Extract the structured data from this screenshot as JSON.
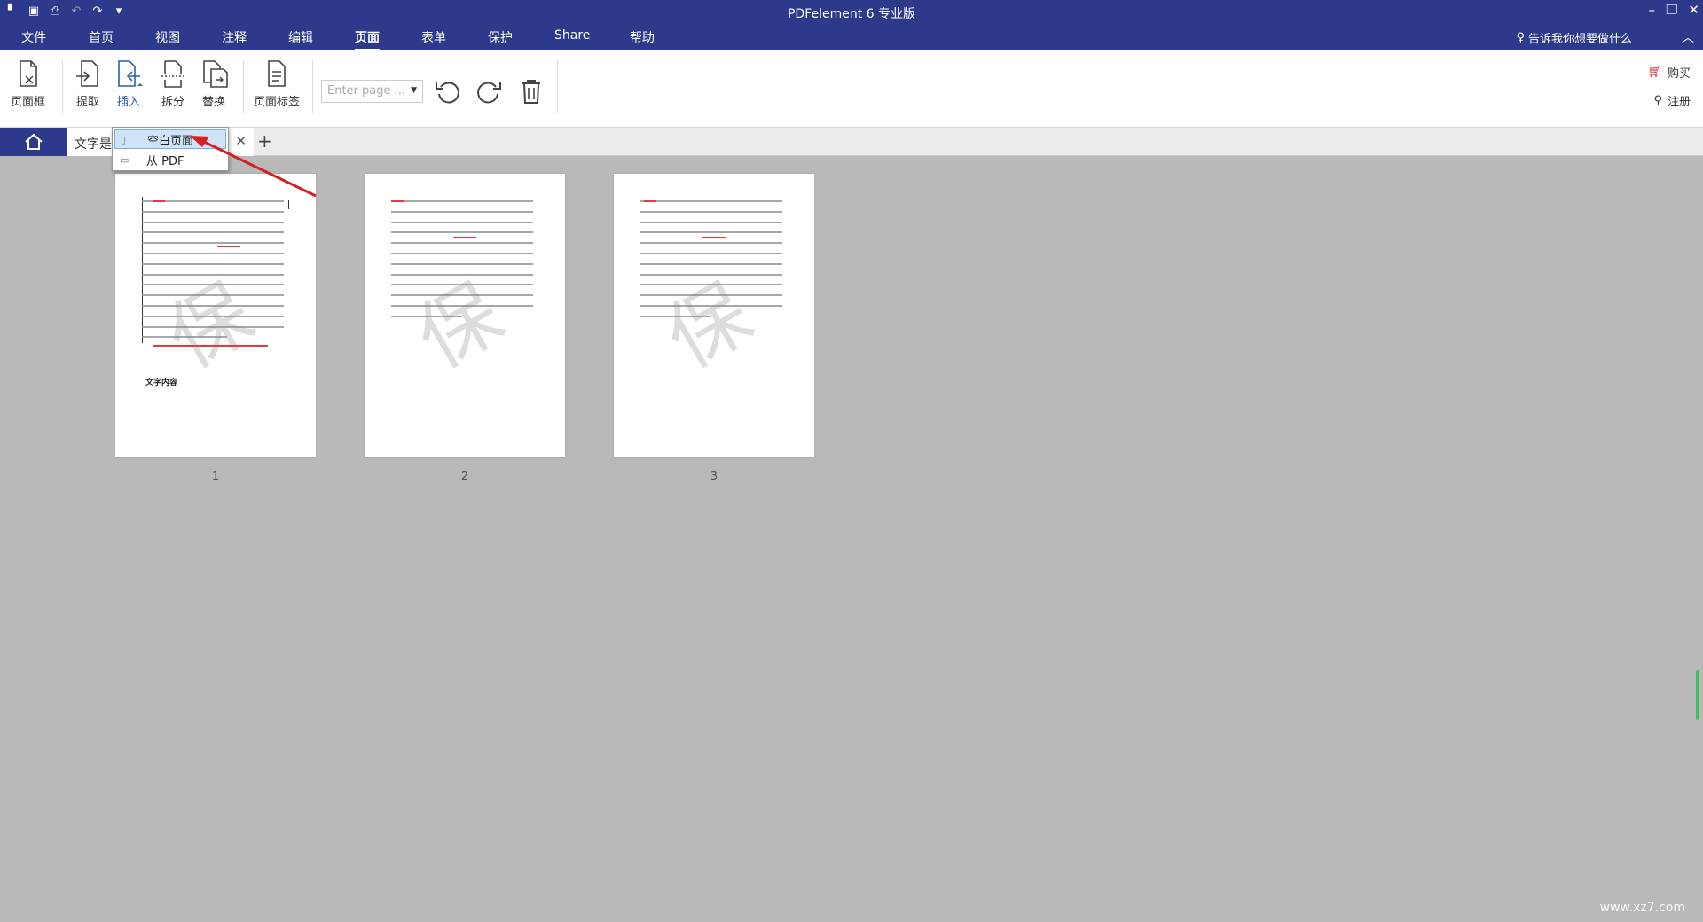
{
  "titlebar": {
    "title": "PDFelement  6 专业版"
  },
  "menu": {
    "tabs": [
      "文件",
      "首页",
      "视图",
      "注释",
      "编辑",
      "页面",
      "表单",
      "保护",
      "Share",
      "帮助"
    ],
    "active": "页面",
    "tell_me": "告诉我你想要做什么"
  },
  "ribbon": {
    "page_box": "页面框",
    "extract": "提取",
    "insert": "插入",
    "split": "拆分",
    "replace": "替换",
    "page_labels": "页面标签",
    "page_input_placeholder": "Enter page ...",
    "buy": "购买",
    "register": "注册"
  },
  "tabs": {
    "doc_title": "文字是"
  },
  "insert_menu": {
    "items": [
      "空白页面",
      "从 PDF"
    ],
    "selected": "空白页面"
  },
  "pages": [
    {
      "number": "1",
      "caption": "文字内容"
    },
    {
      "number": "2"
    },
    {
      "number": "3"
    }
  ],
  "site_watermark": "www.xz7.com",
  "colors": {
    "accent": "#2d3a8c",
    "highlight": "#cfe3f7",
    "arrow": "#d42020"
  }
}
